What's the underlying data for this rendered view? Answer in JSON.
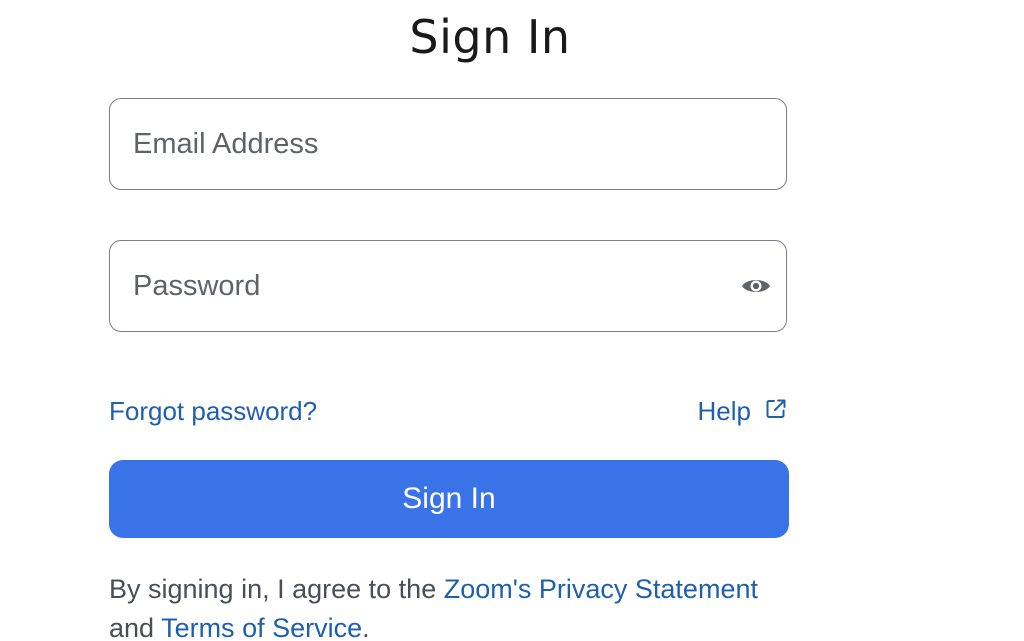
{
  "title": "Sign In",
  "email": {
    "placeholder": "Email Address",
    "value": ""
  },
  "password": {
    "placeholder": "Password",
    "value": ""
  },
  "links": {
    "forgot": "Forgot password?",
    "help": "Help"
  },
  "signin_button": "Sign In",
  "legal": {
    "prefix": "By signing in, I agree to the ",
    "privacy": "Zoom's Privacy Statement",
    "middle": " and ",
    "terms": "Terms of Service",
    "suffix": "."
  },
  "colors": {
    "link": "#1f5fb0",
    "primary_button": "#3a72e8",
    "border": "#7a7f86"
  },
  "icons": {
    "password_toggle": "eye-icon",
    "external": "external-link-icon"
  }
}
